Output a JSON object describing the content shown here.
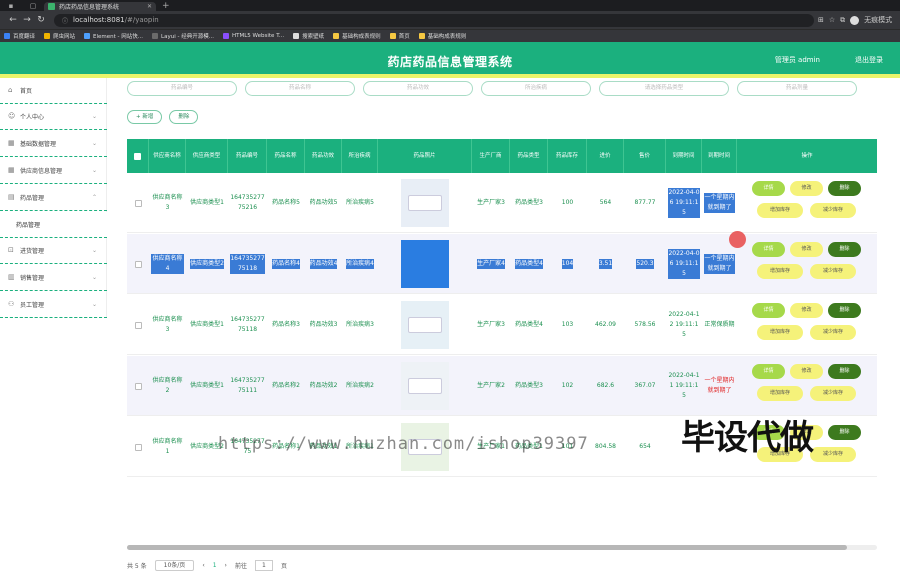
{
  "browser": {
    "tab_title": "药店药品信息管理系统",
    "url_host": "localhost:8081",
    "url_path": "/#/yaopin",
    "profile": "无痕模式",
    "bookmarks": [
      "百度翻译",
      "爬虫网站",
      "Element - 网站快...",
      "Layui - 经典开源模...",
      "HTML5 Website T...",
      "搜索壁纸",
      "基础构成表规则",
      "首页",
      "基础构成表规则"
    ]
  },
  "header": {
    "title": "药店药品信息管理系统",
    "user": "管理员 admin",
    "logout": "退出登录"
  },
  "sidebar": {
    "items": [
      {
        "label": "首页",
        "icon": "home-icon"
      },
      {
        "label": "个人中心",
        "icon": "user-icon"
      },
      {
        "label": "基础数据管理",
        "icon": "grid-icon"
      },
      {
        "label": "供应商信息管理",
        "icon": "grid-icon"
      },
      {
        "label": "药品管理",
        "icon": "doc-icon"
      },
      {
        "label": "药品管理",
        "icon": ""
      },
      {
        "label": "进货管理",
        "icon": "cart-icon"
      },
      {
        "label": "销售管理",
        "icon": "chart-icon"
      },
      {
        "label": "员工管理",
        "icon": "person-icon"
      }
    ]
  },
  "search": {
    "placeholders": [
      "药品编号",
      "药品名称",
      "药品功效",
      "所治疾病",
      "请选择药品类型",
      "药品剂量"
    ]
  },
  "actions": {
    "add": "+ 新增",
    "delete": "删除"
  },
  "table": {
    "headers": [
      "供应商名称",
      "供应商类型",
      "药品编号",
      "药品名称",
      "药品功效",
      "所治疾病",
      "药品照片",
      "生产厂商",
      "药品类型",
      "药品库存",
      "进价",
      "售价",
      "到期时间",
      "到期时间",
      "操作"
    ],
    "rows": [
      {
        "supplier": "供应商名称3",
        "stype": "供应商类型1",
        "code": "16473527775216",
        "name": "药品名称5",
        "effect": "药品功效5",
        "disease": "所治疾病5",
        "maker": "生产厂家3",
        "dtype": "药品类型3",
        "stock": "100",
        "cost": "564",
        "price": "877.77",
        "expire": "2022-04-06 19:11:15",
        "status": "一个星期内就到期了",
        "sel": false
      },
      {
        "supplier": "供应商名称4",
        "stype": "供应商类型2",
        "code": "16473527775118",
        "name": "药品名称4",
        "effect": "药品功效4",
        "disease": "所治疾病4",
        "maker": "生产厂家4",
        "dtype": "药品类型4",
        "stock": "104",
        "cost": "3.51",
        "price": "520.3",
        "expire": "2022-04-06 19:11:15",
        "status": "一个星期内就到期了",
        "sel": true
      },
      {
        "supplier": "供应商名称3",
        "stype": "供应商类型1",
        "code": "16473527775118",
        "name": "药品名称3",
        "effect": "药品功效3",
        "disease": "所治疾病3",
        "maker": "生产厂家3",
        "dtype": "药品类型4",
        "stock": "103",
        "cost": "462.09",
        "price": "578.56",
        "expire": "2022-04-12 19:11:15",
        "status": "正常保质期",
        "sel": false
      },
      {
        "supplier": "供应商名称2",
        "stype": "供应商类型1",
        "code": "16473527775111",
        "name": "药品名称2",
        "effect": "药品功效2",
        "disease": "所治疾病2",
        "maker": "生产厂家2",
        "dtype": "药品类型3",
        "stock": "102",
        "cost": "682.6",
        "price": "367.07",
        "expire": "2022-04-11 19:11:15",
        "status": "一个星期内就到期了",
        "sel": false
      },
      {
        "supplier": "供应商名称1",
        "stype": "供应商类型2",
        "code": "16473527775",
        "name": "药品名称1",
        "effect": "药品功效1",
        "disease": "所治疾病1",
        "maker": "生产厂家1",
        "dtype": "药品类型1",
        "stock": "101",
        "cost": "804.58",
        "price": "654",
        "expire": "",
        "status": "",
        "sel": false
      }
    ],
    "ops": {
      "detail": "详情",
      "edit": "修改",
      "del": "删除",
      "inc": "增加库存",
      "dec": "减少库存"
    }
  },
  "pager": {
    "total": "共 5 条",
    "size": "10条/页",
    "page": "1",
    "goto": "前往",
    "goto_val": "1",
    "unit": "页"
  },
  "watermark": {
    "url": "https://www.huzhan.com/ishop39397",
    "cn": "毕设代做"
  }
}
